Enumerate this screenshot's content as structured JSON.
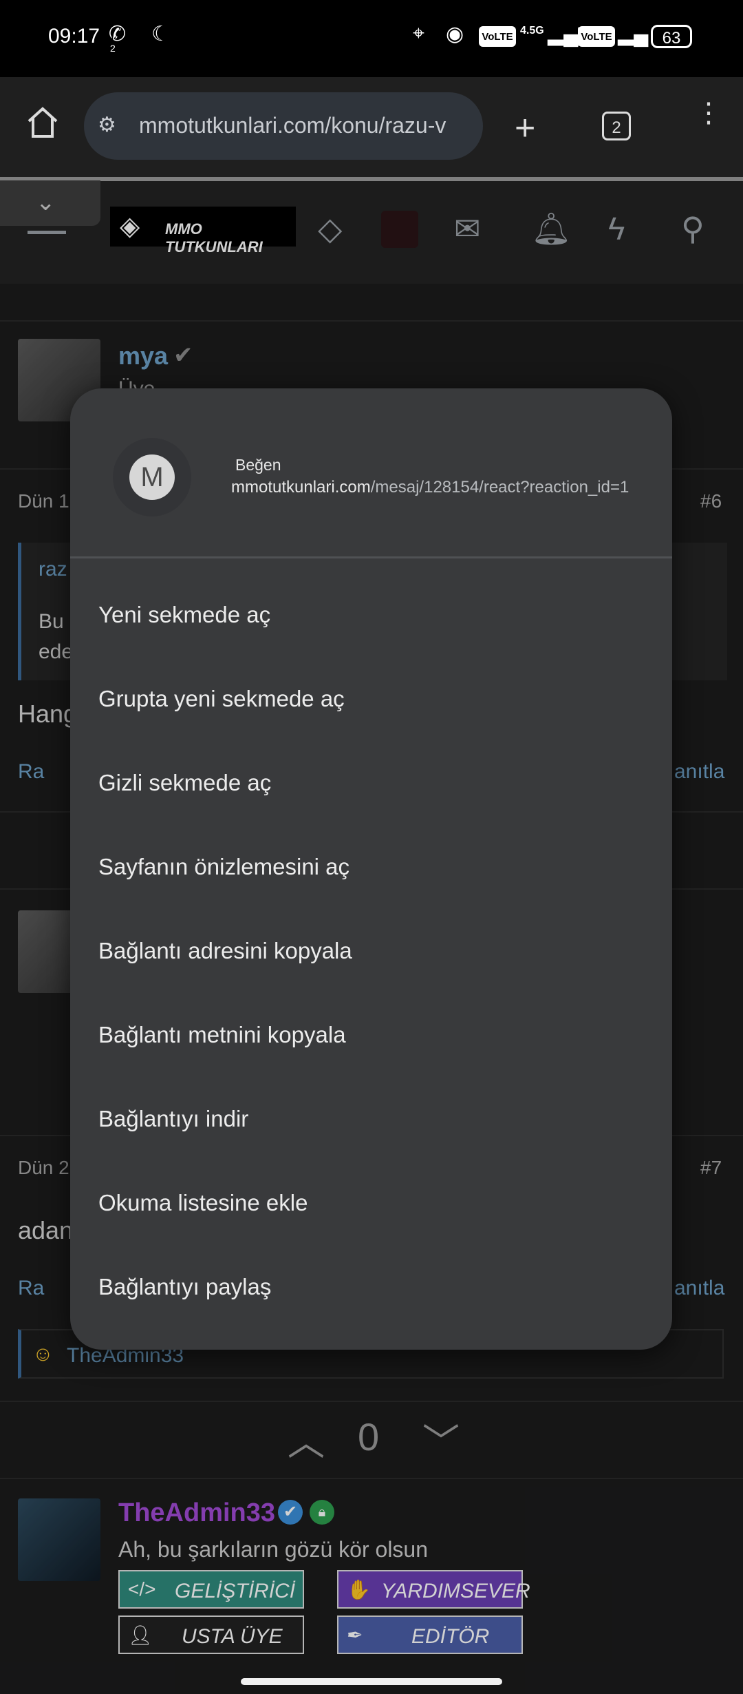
{
  "status_bar": {
    "time": "09:17",
    "call_badge": "2",
    "volte1": "VoLTE",
    "network": "4.5G",
    "volte2": "VoLTE",
    "battery": "63"
  },
  "browser": {
    "url": "mmotutkunlari.com/konu/razu-v",
    "tab_count": "2"
  },
  "site": {
    "logo_text": "MMO TUTKUNLARI"
  },
  "background": {
    "post1": {
      "username": "mya",
      "role": "Üye",
      "date": "Dün 1",
      "number": "#6",
      "quote_author": "raz",
      "quote_line1": "Bu",
      "quote_line2": "ede",
      "body": "Hang",
      "report": "Ra",
      "reply": "anıtla"
    },
    "post2": {
      "date": "Dün 2",
      "number": "#7",
      "body": "adan",
      "report": "Ra",
      "reply": "anıtla",
      "reaction_user": "TheAdmin33"
    },
    "vote": {
      "count": "0"
    },
    "author": {
      "username": "TheAdmin33",
      "tagline": "Ah, bu şarkıların gözü kör olsun",
      "badges": [
        "GELİŞTİRİCİ",
        "YARDIMSEVER",
        "USTA ÜYE",
        "EDİTÖR"
      ]
    }
  },
  "context_menu": {
    "avatar_letter": "M",
    "title": "Beğen",
    "link_domain": "mmotutkunlari.com",
    "link_path": "/mesaj/128154/react?reaction_id=1",
    "items": [
      "Yeni sekmede aç",
      "Grupta yeni sekmede aç",
      "Gizli sekmede aç",
      "Sayfanın önizlemesini aç",
      "Bağlantı adresini kopyala",
      "Bağlantı metnini kopyala",
      "Bağlantıyı indir",
      "Okuma listesine ekle",
      "Bağlantıyı paylaş"
    ]
  }
}
